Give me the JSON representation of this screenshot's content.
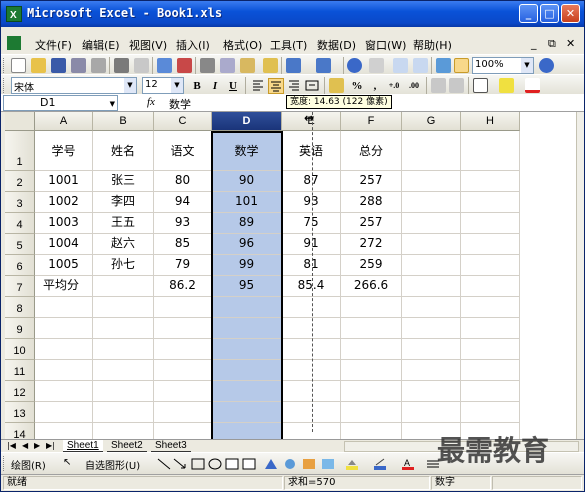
{
  "window": {
    "title": "Microsoft Excel - Book1.xls",
    "controls": {
      "minimize": "_",
      "maximize": "□",
      "close": "✕"
    }
  },
  "menubar": {
    "items": [
      "文件(F)",
      "编辑(E)",
      "视图(V)",
      "插入(I)",
      "格式(O)",
      "工具(T)",
      "数据(D)",
      "窗口(W)",
      "帮助(H)"
    ],
    "right_controls": {
      "minimize": "_",
      "restore": "⧉",
      "close": "✕"
    }
  },
  "toolbar": {
    "zoom": "100%",
    "font_name": "宋体",
    "font_size": "12",
    "bold": "B",
    "italic": "I",
    "underline": "U",
    "percent": "%",
    "comma": ",",
    "inc_decimal": "+.0",
    "dec_decimal": ".00"
  },
  "formula_bar": {
    "name_box": "D1",
    "fx": "fx",
    "value": "数学"
  },
  "tooltip": "宽度: 14.63 (122 像素)",
  "sheet": {
    "columns": [
      "A",
      "B",
      "C",
      "D",
      "E",
      "F",
      "G",
      "H"
    ],
    "selected_column": "D",
    "rows": [
      "1",
      "2",
      "3",
      "4",
      "5",
      "6",
      "7",
      "8",
      "9",
      "10",
      "11",
      "12",
      "13",
      "14"
    ],
    "cells": [
      [
        "学号",
        "姓名",
        "语文",
        "数学",
        "英语",
        "总分",
        "",
        ""
      ],
      [
        "1001",
        "张三",
        "80",
        "90",
        "87",
        "257",
        "",
        ""
      ],
      [
        "1002",
        "李四",
        "94",
        "101",
        "93",
        "288",
        "",
        ""
      ],
      [
        "1003",
        "王五",
        "93",
        "89",
        "75",
        "257",
        "",
        ""
      ],
      [
        "1004",
        "赵六",
        "85",
        "96",
        "91",
        "272",
        "",
        ""
      ],
      [
        "1005",
        "孙七",
        "79",
        "99",
        "81",
        "259",
        "",
        ""
      ],
      [
        "平均分",
        "",
        "86.2",
        "95",
        "85.4",
        "266.6",
        "",
        ""
      ]
    ],
    "tabs": [
      "Sheet1",
      "Sheet2",
      "Sheet3"
    ],
    "active_tab": "Sheet1"
  },
  "draw_toolbar": {
    "draw_label": "绘图(R)",
    "autoshapes_label": "自选图形(U)"
  },
  "statusbar": {
    "ready": "就绪",
    "sum": "求和=570",
    "mode": "数字"
  },
  "watermark": "最需教育",
  "colors": {
    "titlebar": "#0a52d8",
    "selection_fill": "#b6c9e8",
    "selected_header": "#1a3479"
  }
}
